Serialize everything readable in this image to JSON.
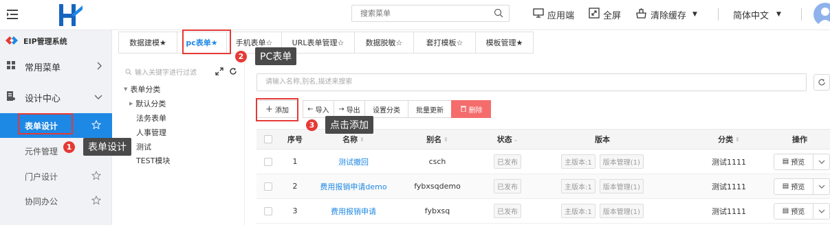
{
  "header": {
    "search_placeholder": "搜索菜单",
    "actions": {
      "app": "应用端",
      "fullscreen": "全屏",
      "clear_cache": "清除缓存",
      "language": "简体中文"
    }
  },
  "sidebar": {
    "system_name": "EIP管理系统",
    "groups": {
      "common": "常用菜单",
      "design": "设计中心"
    },
    "items": [
      {
        "label": "表单设计"
      },
      {
        "label": "元件管理"
      },
      {
        "label": "门户设计"
      },
      {
        "label": "协同办公"
      }
    ]
  },
  "tabs": [
    {
      "label": "数据建模★"
    },
    {
      "label": "pc表单★"
    },
    {
      "label": "手机表单☆"
    },
    {
      "label": "URL表单管理☆"
    },
    {
      "label": "数据脱敏☆"
    },
    {
      "label": "套打模板☆"
    },
    {
      "label": "模板管理★"
    }
  ],
  "tree": {
    "search_placeholder": "输入关键字进行过滤",
    "root": "表单分类",
    "nodes": [
      "默认分类",
      "法务表单",
      "人事管理",
      "测试",
      "TEST模块"
    ]
  },
  "main": {
    "search_placeholder": "请输入名称,别名,描述来搜索",
    "toolbar": {
      "add": "添加",
      "import": "导入",
      "export": "导出",
      "set_category": "设置分类",
      "batch_update": "批量更新",
      "delete": "删除"
    }
  },
  "table": {
    "headers": {
      "index": "序号",
      "name": "名称",
      "alias": "别名",
      "status": "状态",
      "version": "版本",
      "category": "分类",
      "action": "操作"
    },
    "rows": [
      {
        "index": "1",
        "name": "测试撤回",
        "alias": "csch",
        "status": "已发布",
        "main_version": "主版本:1",
        "version_manage": "版本管理(1)",
        "category": "测试1111",
        "action": "预览"
      },
      {
        "index": "2",
        "name": "费用报销申请demo",
        "alias": "fybxsqdemo",
        "status": "已发布",
        "main_version": "主版本:1",
        "version_manage": "版本管理(1)",
        "category": "测试1111",
        "action": "预览"
      },
      {
        "index": "3",
        "name": "费用报销申请",
        "alias": "fybxsq",
        "status": "已发布",
        "main_version": "主版本:1",
        "version_manage": "版本管理(1)",
        "category": "测试1111",
        "action": "预览"
      }
    ]
  },
  "annotations": [
    {
      "number": "1",
      "text": "表单设计"
    },
    {
      "number": "2",
      "text": "PC表单"
    },
    {
      "number": "3",
      "text": "点击添加"
    }
  ],
  "colors": {
    "accent": "#1e88e5",
    "danger": "#f56c6c",
    "annotation": "#e53935"
  }
}
